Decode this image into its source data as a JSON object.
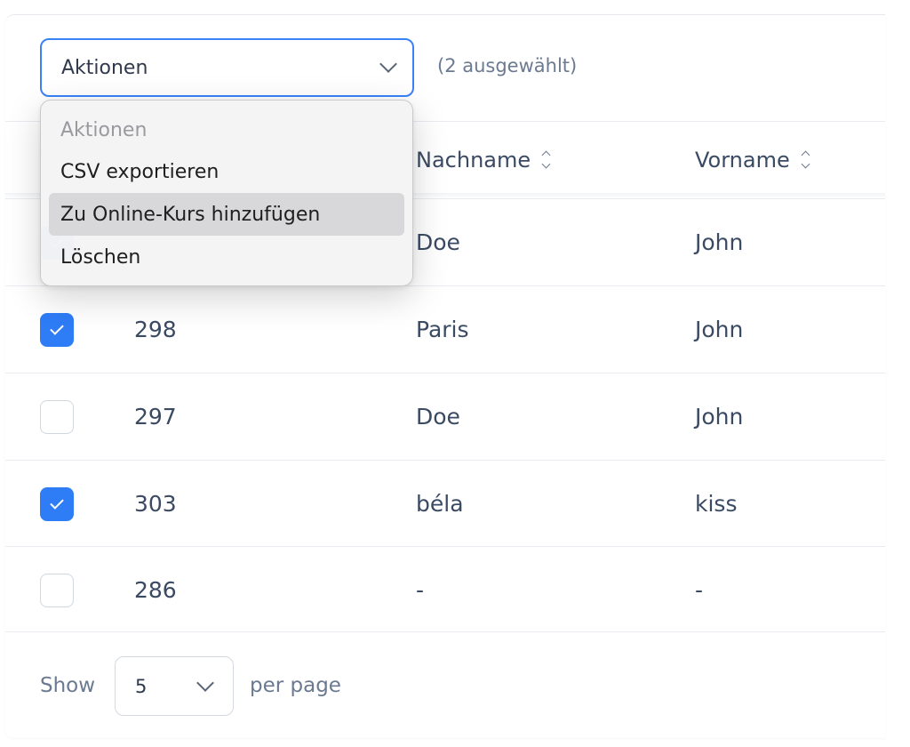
{
  "toolbar": {
    "actions_value": "Aktionen",
    "selected_count": "(2 ausgewählt)"
  },
  "actions_menu": {
    "items": [
      {
        "label": "Aktionen",
        "disabled": true
      },
      {
        "label": "CSV exportieren",
        "disabled": false
      },
      {
        "label": "Zu Online-Kurs hinzufügen",
        "disabled": false,
        "highlighted": true
      },
      {
        "label": "Löschen",
        "disabled": false
      }
    ]
  },
  "table": {
    "columns": {
      "last_name": "Nachname",
      "first_name": "Vorname"
    },
    "rows": [
      {
        "checked": true,
        "id": "",
        "last_name": "Doe",
        "first_name": "John"
      },
      {
        "checked": true,
        "id": "298",
        "last_name": "Paris",
        "first_name": "John"
      },
      {
        "checked": false,
        "id": "297",
        "last_name": "Doe",
        "first_name": "John"
      },
      {
        "checked": true,
        "id": "303",
        "last_name": "béla",
        "first_name": "kiss"
      },
      {
        "checked": false,
        "id": "286",
        "last_name": "-",
        "first_name": "-"
      }
    ]
  },
  "pagination": {
    "show_label": "Show",
    "per_page_value": "5",
    "per_page_label": "per page"
  },
  "colors": {
    "accent": "#2e7cf6",
    "text": "#3b4a63",
    "muted": "#6b7a90"
  }
}
